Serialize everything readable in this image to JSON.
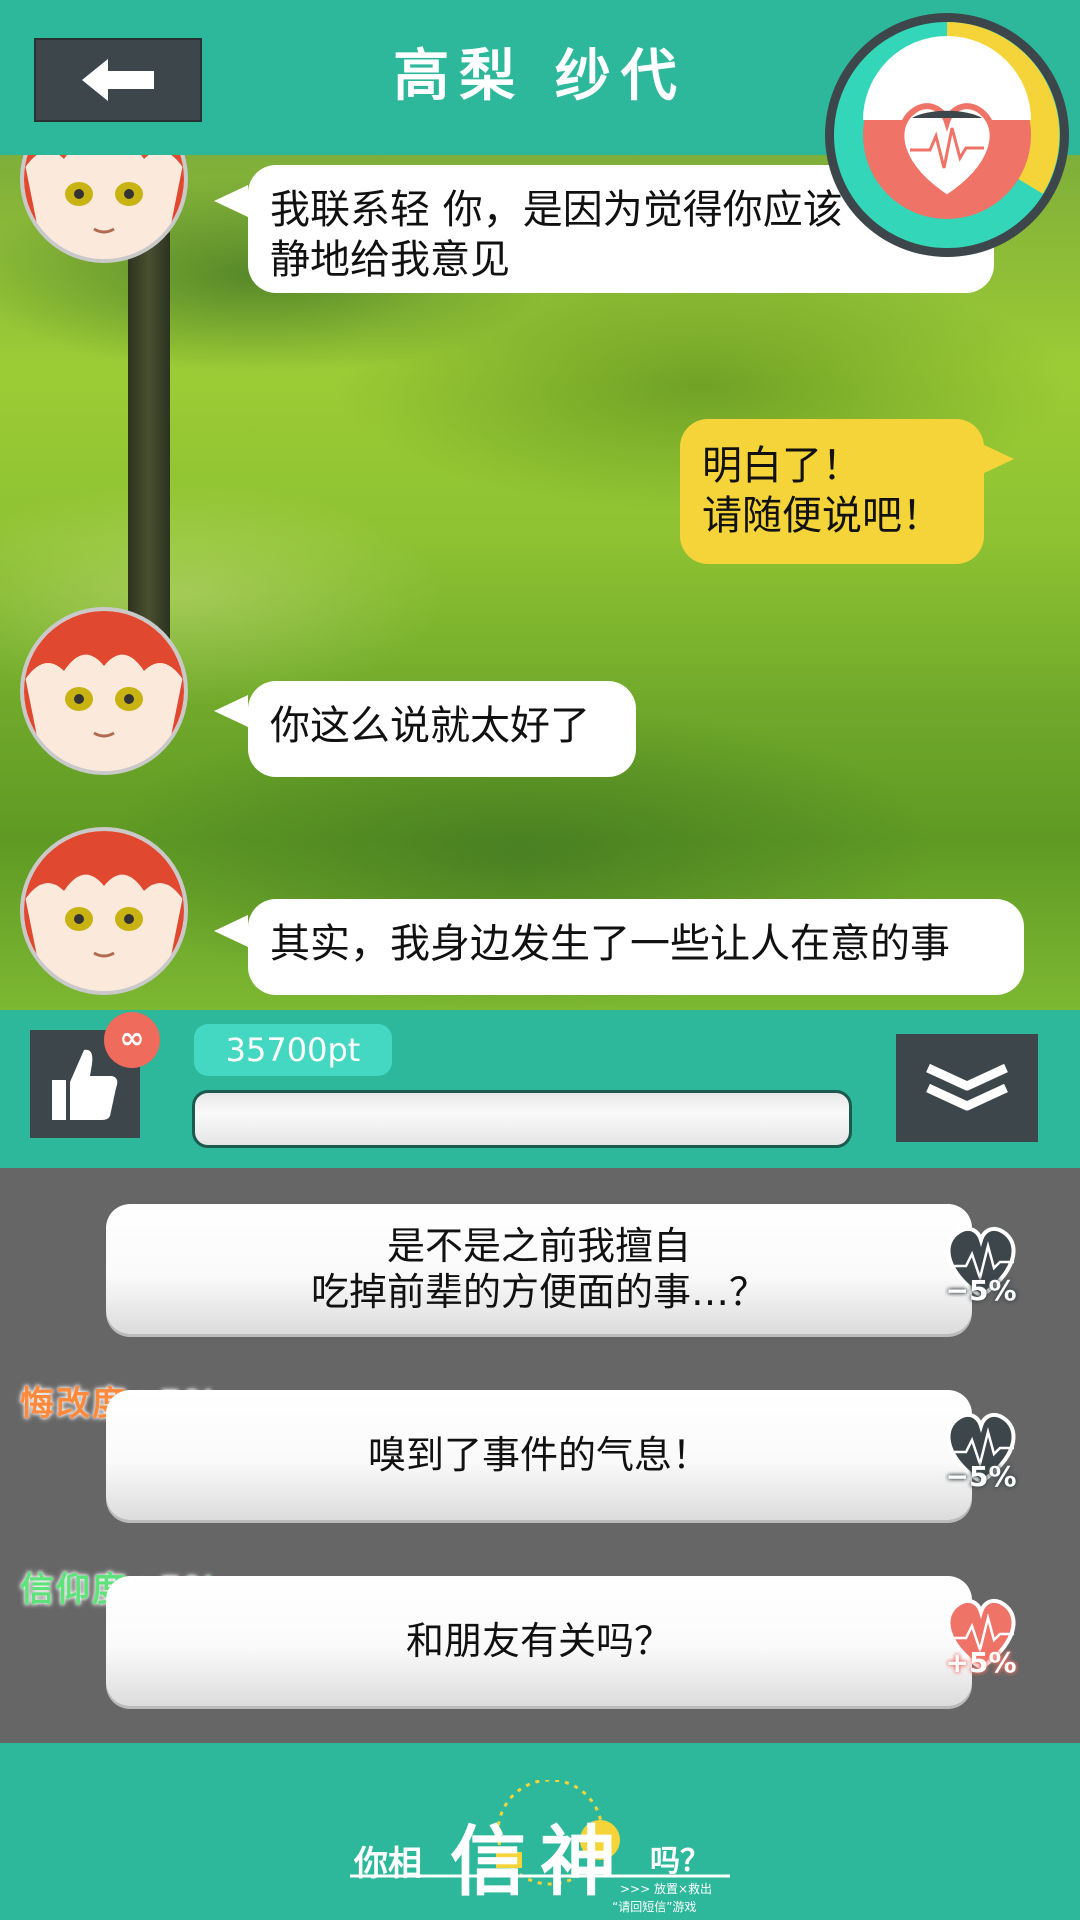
{
  "header": {
    "title": "高梨 纱代",
    "back_icon": "arrow-left-icon"
  },
  "gauge": {
    "icon": "heartbeat-icon",
    "colors": {
      "ring_teal": "#33d6b9",
      "ring_yellow": "#f5d43a",
      "heart_bg": "#ef7367"
    }
  },
  "messages": [
    {
      "sender": "character",
      "text_line1": "我联系轻 你，是因为觉得你应该",
      "text_line2": "静地给我意见"
    },
    {
      "sender": "me",
      "text_line1": "明白了！",
      "text_line2": "请随便说吧！"
    },
    {
      "sender": "character",
      "text": "你这么说就太好了"
    },
    {
      "sender": "character",
      "text": "其实，我身边发生了一些让人在意的事"
    }
  ],
  "input": {
    "like_icon": "thumbs-up-icon",
    "badge": "∞",
    "points": "35700pt",
    "collapse_icon": "double-chevron-down-icon"
  },
  "options": [
    {
      "line1": "是不是之前我擅自",
      "line2": "吃掉前辈的方便面的事…？",
      "effect": "−5%",
      "heart_color": "#3d474b"
    },
    {
      "text": "嗅到了事件的气息！",
      "effect": "−5%",
      "heart_color": "#3d474b",
      "bonus": "悔改度+5%",
      "bonus_color": "#ff8a3d"
    },
    {
      "text": "和朋友有关吗？",
      "effect": "+5%",
      "heart_color": "#ef7367",
      "bonus": "信仰度+5%",
      "bonus_color": "#5ee37a"
    }
  ],
  "footer": {
    "logo_text_1": "你相",
    "logo_char_1": "信",
    "logo_char_2": "神",
    "logo_text_2": "吗？",
    "tagline_1": ">>> 放置×救出",
    "tagline_2": "“请回短信”游戏"
  }
}
